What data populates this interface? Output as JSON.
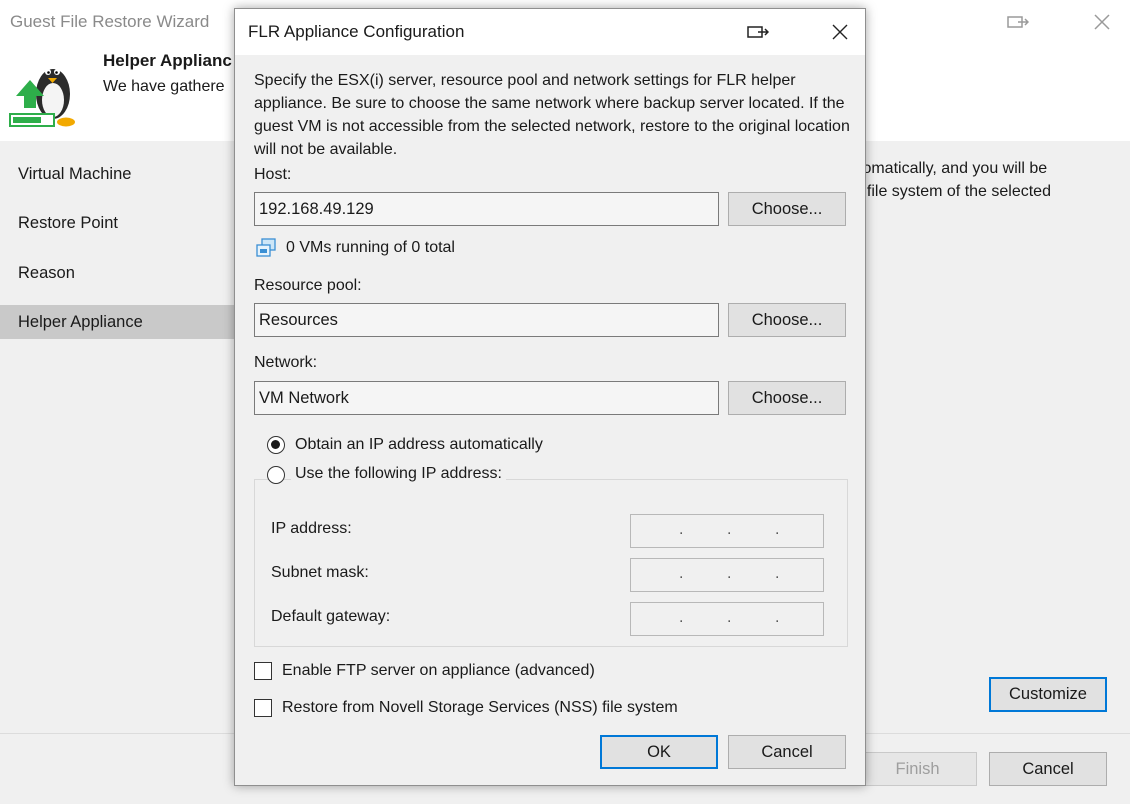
{
  "wizard": {
    "title": "Guest File Restore Wizard",
    "header_title": "Helper Applianc",
    "header_desc": "We have gathere",
    "steps": [
      {
        "label": "Virtual Machine",
        "active": false
      },
      {
        "label": "Restore Point",
        "active": false
      },
      {
        "label": "Reason",
        "active": false
      },
      {
        "label": "Helper Appliance",
        "active": true
      }
    ],
    "content_line1": "tomatically, and you will be",
    "content_line2": "t file system of the selected",
    "customize_label": "Customize",
    "finish_label": "Finish",
    "cancel_label": "Cancel",
    "icons": {
      "logo": "linux-penguin-upload-icon",
      "popout": "popout-icon",
      "close": "close-icon"
    }
  },
  "dialog": {
    "title": "FLR Appliance Configuration",
    "intro": "Specify the ESX(i) server, resource pool and network settings for FLR helper appliance. Be sure to choose the same network where backup server located. If the guest VM is not accessible from the selected network, restore to the original location will not be available.",
    "host_label": "Host:",
    "host_value": "192.168.49.129",
    "choose_label": "Choose...",
    "vm_status": "0 VMs running of 0 total",
    "resource_pool_label": "Resource pool:",
    "resource_pool_value": "Resources",
    "network_label": "Network:",
    "network_value": "VM Network",
    "radio_auto": "Obtain an IP address automatically",
    "radio_manual": "Use the following IP address:",
    "selected_radio": "auto",
    "ip_label": "IP address:",
    "subnet_label": "Subnet mask:",
    "gateway_label": "Default gateway:",
    "ftp_label": "Enable FTP server on appliance (advanced)",
    "ftp_checked": false,
    "nss_label": "Restore from Novell Storage Services (NSS) file system",
    "nss_checked": false,
    "ok_label": "OK",
    "cancel_label": "Cancel"
  },
  "colors": {
    "accent": "#0078d7",
    "logo_green": "#2eae4a",
    "active_step": "#c9c9c9"
  }
}
